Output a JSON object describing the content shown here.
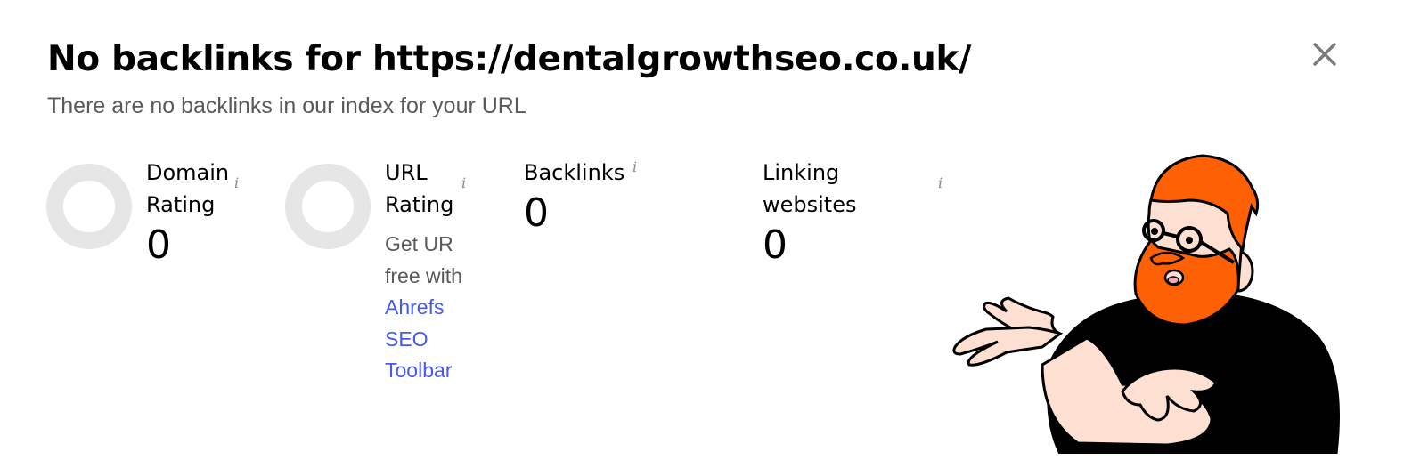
{
  "dialog": {
    "title": "No backlinks for https://dentalgrowthseo.co.uk/",
    "subtitle": "There are no backlinks in our index for your URL",
    "close_icon": "close-icon"
  },
  "metrics": {
    "domain_rating": {
      "label_line1": "Domain",
      "label_line2": "Rating",
      "value": "0",
      "info": "i",
      "gauge_fill": 0
    },
    "url_rating": {
      "label_line1": "URL",
      "label_line2": "Rating",
      "info": "i",
      "gauge_fill": 0,
      "promo_text": "Get UR free with",
      "promo_link": "Ahrefs SEO Toolbar"
    },
    "backlinks": {
      "label": "Backlinks",
      "value": "0",
      "info": "i"
    },
    "linking_websites": {
      "label_line1": "Linking",
      "label_line2": "websites",
      "value": "0",
      "info": "i"
    }
  },
  "colors": {
    "gauge_track": "#e6e6e6",
    "link": "#4657f5",
    "mascot_hair": "#fe6006",
    "mascot_shirt": "#000000",
    "mascot_skin": "#fde0d2"
  }
}
